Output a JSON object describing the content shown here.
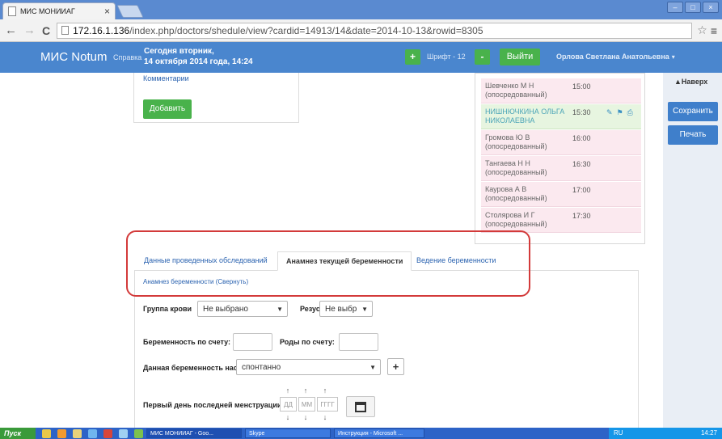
{
  "browser": {
    "tab_title": "МИС МОНИИАГ",
    "tab_close": "×",
    "url_host": "172.16.1.136",
    "url_path": "/index.php/doctors/shedule/view?cardid=14913/14&date=2014-10-13&rowid=8305",
    "back": "←",
    "forward": "→",
    "reload": "C",
    "star": "☆",
    "menu": "≡",
    "win_min": "–",
    "win_max": "□",
    "win_close": "×"
  },
  "header": {
    "brand": "МИС Notum",
    "help": "Справка",
    "today_line1": "Сегодня вторник,",
    "today_line2": "14 октября 2014 года, 14:24",
    "font_plus": "+",
    "font_label": "Шрифт - 12",
    "font_minus": "-",
    "logout": "Выйти",
    "user": "Орлова Светлана Анатольевна",
    "user_caret": "▾"
  },
  "sidebar": {
    "up": "▲Наверх",
    "save": "Сохранить",
    "print": "Печать"
  },
  "comments": {
    "label": "Комментарии",
    "add_button": "Добавить"
  },
  "schedule": [
    {
      "name": "Шевченко М Н (опосредованный)",
      "time": "15:00",
      "active": false
    },
    {
      "name": "НИШНЮЧКИНА ОЛЬГА НИКОЛАЕВНА",
      "time": "15:30",
      "active": true
    },
    {
      "name": "Громова Ю В (опосредованный)",
      "time": "16:00",
      "active": false
    },
    {
      "name": "Тангаева Н Н (опосредованный)",
      "time": "16:30",
      "active": false
    },
    {
      "name": "Каурова А В (опосредованный)",
      "time": "17:00",
      "active": false
    },
    {
      "name": "Столярова И Г (опосредованный)",
      "time": "17:30",
      "active": false
    }
  ],
  "tabs": {
    "items": [
      {
        "label": "Данные проведенных обследований",
        "active": false
      },
      {
        "label": "Анамнез текущей беременности",
        "active": true
      },
      {
        "label": "Ведение беременности",
        "active": false
      }
    ],
    "collapse_link": "Анамнез беременности (Свернуть)"
  },
  "form": {
    "blood_group_label": "Группа крови",
    "blood_group_value": "Не выбрано",
    "rh_label": "Резус",
    "rh_value": "Не выбр",
    "pregnancy_count_label": "Беременность по счету:",
    "birth_count_label": "Роды по счету:",
    "onset_label": "Данная беременность наступила:",
    "onset_value": "спонтанно",
    "add_plus": "+",
    "lmp_label": "Первый день последней менструации:",
    "date_day": "ДД",
    "date_month": "ММ",
    "date_year": "ГГГГ",
    "arrow_up": "↑",
    "arrow_down": "↓"
  },
  "taskbar": {
    "start": "Пуск",
    "tasks": [
      "МИС МОНИИАГ - Goo...",
      "Skype",
      "Инструкция - Microsoft ..."
    ],
    "lang": "RU",
    "clock": "14:27"
  }
}
